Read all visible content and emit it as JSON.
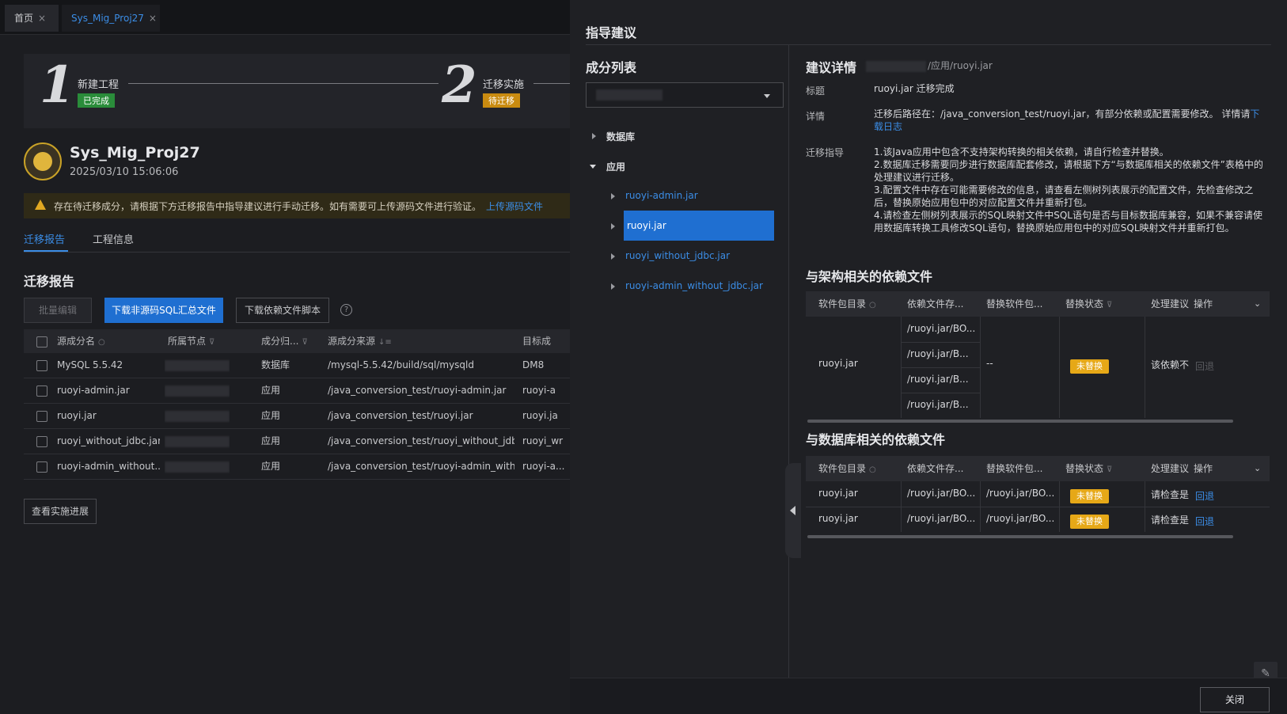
{
  "tabs": [
    {
      "label": "首页",
      "close": "×"
    },
    {
      "label": "Sys_Mig_Proj27",
      "close": "×"
    }
  ],
  "steps": [
    {
      "num": "1",
      "name": "新建工程",
      "status": "已完成"
    },
    {
      "num": "2",
      "name": "迁移实施",
      "status": "待迁移"
    }
  ],
  "project": {
    "name": "Sys_Mig_Proj27",
    "date": "2025/03/10 15:06:06"
  },
  "warning": {
    "text": "存在待迁移成分，请根据下方迁移报告中指导建议进行手动迁移。如有需要可上传源码文件进行验证。",
    "link": "上传源码文件"
  },
  "report_tabs": [
    "迁移报告",
    "工程信息"
  ],
  "report": {
    "title": "迁移报告",
    "buttons": {
      "batch_edit": "批量编辑",
      "download_sql": "下载非源码SQL汇总文件",
      "download_dep": "下载依赖文件脚本"
    },
    "help": "?",
    "columns": [
      "源成分名",
      "所属节点",
      "成分归...",
      "源成分来源",
      "目标成"
    ],
    "rows": [
      {
        "name": "MySQL 5.5.42",
        "type": "数据库",
        "source": "/mysql-5.5.42/build/sql/mysqld",
        "target": "DM8"
      },
      {
        "name": "ruoyi-admin.jar",
        "type": "应用",
        "source": "/java_conversion_test/ruoyi-admin.jar",
        "target": "ruoyi-a"
      },
      {
        "name": "ruoyi.jar",
        "type": "应用",
        "source": "/java_conversion_test/ruoyi.jar",
        "target": "ruoyi.ja"
      },
      {
        "name": "ruoyi_without_jdbc.jar",
        "type": "应用",
        "source": "/java_conversion_test/ruoyi_without_jdbc...",
        "target": "ruoyi_wr"
      },
      {
        "name": "ruoyi-admin_without...",
        "type": "应用",
        "source": "/java_conversion_test/ruoyi-admin_witho...",
        "target": "ruoyi-a..."
      }
    ],
    "progress_button": "查看实施进展"
  },
  "drawer": {
    "title": "指导建议",
    "list_title": "成分列表",
    "tree": {
      "database": "数据库",
      "app": "应用",
      "items": [
        "ruoyi-admin.jar",
        "ruoyi.jar",
        "ruoyi_without_jdbc.jar",
        "ruoyi-admin_without_jdbc.jar"
      ]
    },
    "detail": {
      "title": "建议详情",
      "path": "/应用/ruoyi.jar",
      "label_title": "标题",
      "value_title": "ruoyi.jar 迁移完成",
      "label_detail": "详情",
      "value_detail": "迁移后路径在：/java_conversion_test/ruoyi.jar，有部分依赖或配置需要修改。 详情请",
      "value_detail_link": "下载日志",
      "label_guide": "迁移指导",
      "guide": [
        "1.该Java应用中包含不支持架构转换的相关依赖，请自行检查并替换。",
        "2.数据库迁移需要同步进行数据库配套修改，请根据下方“与数据库相关的依赖文件”表格中的处理建议进行迁移。",
        "3.配置文件中存在可能需要修改的信息，请查看左侧树列表展示的配置文件，先检查修改之后，替换原始应用包中的对应配置文件并重新打包。",
        "4.请检查左侧树列表展示的SQL映射文件中SQL语句是否与目标数据库兼容，如果不兼容请使用数据库转换工具修改SQL语句，替换原始应用包中的对应SQL映射文件并重新打包。"
      ]
    },
    "arch_section": {
      "title": "与架构相关的依赖文件",
      "columns": [
        "软件包目录",
        "依赖文件存...",
        "替换软件包...",
        "替换状态",
        "处理建议",
        "操作"
      ],
      "row": {
        "pkg": "ruoyi.jar",
        "deps": [
          "/ruoyi.jar/BO...",
          "/ruoyi.jar/B...",
          "/ruoyi.jar/B...",
          "/ruoyi.jar/B..."
        ],
        "replace": "--",
        "status": "未替换",
        "advice": "该依赖不",
        "op": "回退"
      }
    },
    "db_section": {
      "title": "与数据库相关的依赖文件",
      "columns": [
        "软件包目录",
        "依赖文件存...",
        "替换软件包...",
        "替换状态",
        "处理建议",
        "操作"
      ],
      "rows": [
        {
          "pkg": "ruoyi.jar",
          "dep": "/ruoyi.jar/BO...",
          "replace": "/ruoyi.jar/BO...",
          "status": "未替换",
          "advice": "请检查是",
          "op": "回退"
        },
        {
          "pkg": "ruoyi.jar",
          "dep": "/ruoyi.jar/BO...",
          "replace": "/ruoyi.jar/BO...",
          "status": "未替换",
          "advice": "请检查是",
          "op": "回退"
        }
      ]
    },
    "close_button": "关闭"
  },
  "colors": {
    "accent": "#1f6fd1",
    "link": "#3b8de6",
    "warning": "#e6a817",
    "success": "#2a8c3a"
  }
}
